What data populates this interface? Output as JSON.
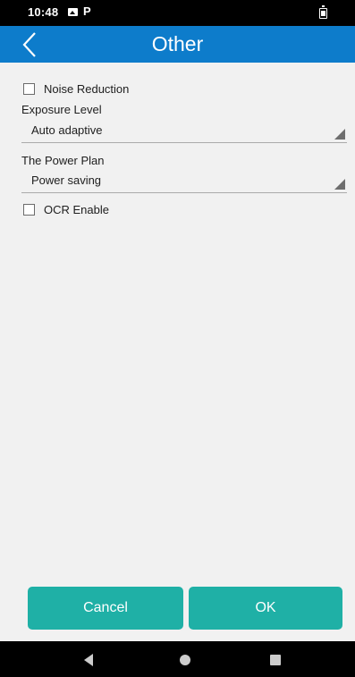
{
  "status_bar": {
    "time": "10:48",
    "icons": [
      "image-notification-icon",
      "p-notification-icon",
      "battery-icon"
    ],
    "p_glyph": "P"
  },
  "app_bar": {
    "title": "Other",
    "back_icon": "chevron-left-icon",
    "color": "#0d7ccb"
  },
  "settings": {
    "noise_reduction": {
      "label": "Noise Reduction",
      "checked": false
    },
    "exposure_level": {
      "label": "Exposure Level",
      "value": "Auto adaptive"
    },
    "power_plan": {
      "label": "The Power Plan",
      "value": "Power saving"
    },
    "ocr_enable": {
      "label": "OCR Enable",
      "checked": false
    }
  },
  "buttons": {
    "cancel_label": "Cancel",
    "ok_label": "OK",
    "color": "#1fb0a6"
  },
  "nav_bar": {
    "icons": [
      "back-triangle-icon",
      "home-circle-icon",
      "recents-square-icon"
    ]
  }
}
